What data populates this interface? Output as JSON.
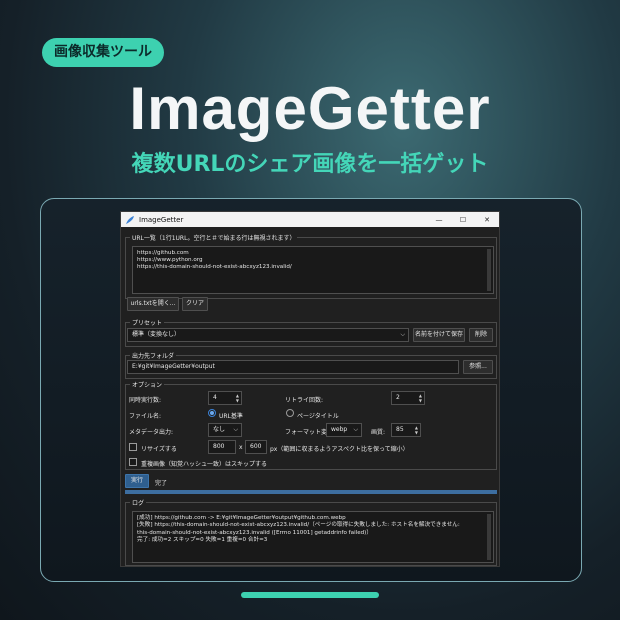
{
  "promo": {
    "badge": "画像収集ツール",
    "title": "ImageGetter",
    "subtitle": "複数URLのシェア画像を一括ゲット"
  },
  "window": {
    "title": "ImageGetter",
    "min": "—",
    "max": "☐",
    "close": "✕"
  },
  "url_list": {
    "label": "URL一覧（1行1URL。空行と＃で始まる行は無視されます）",
    "lines": [
      "https://github.com",
      "https://www.python.org",
      "https://this-domain-should-not-exist-abcxyz123.invalid/"
    ],
    "open_button": "urls.txtを開く...",
    "clear_button": "クリア"
  },
  "preset": {
    "label": "プリセット",
    "selected": "標準（変換なし）",
    "save_button": "名前を付けて保存",
    "delete_button": "削除"
  },
  "output": {
    "label": "出力先フォルダ",
    "path": "E:¥git¥ImageGetter¥output",
    "browse_button": "参照..."
  },
  "options": {
    "label": "オプション",
    "concurrency_label": "同時実行数:",
    "concurrency_value": "4",
    "retry_label": "リトライ回数:",
    "retry_value": "2",
    "filename_label": "ファイル名:",
    "filename_url": "URL基準",
    "filename_title": "ページタイトル",
    "filename_selected": "URL基準",
    "metadata_label": "メタデータ出力:",
    "metadata_value": "なし",
    "format_label": "フォーマット変換:",
    "format_value": "webp",
    "quality_label": "画質:",
    "quality_value": "85",
    "resize_label": "リサイズする",
    "resize_checked": false,
    "width_value": "800",
    "times": "x",
    "height_value": "600",
    "resize_note": "px（範囲に収まるようアスペクト比を保って縮小）",
    "skip_dup_label": "重複画像（知覚ハッシュ一致）はスキップする",
    "skip_dup_checked": false
  },
  "actions": {
    "run_button": "実行",
    "status": "完了",
    "progress": 1.0
  },
  "log": {
    "label": "ログ",
    "lines": [
      "[成功] https://github.com -> E:¥git¥ImageGetter¥output¥github.com.webp",
      "[失敗] https://this-domain-should-not-exist-abcxyz123.invalid/（ページの取得に失敗しました: ホスト名を解決できません:",
      "this-domain-should-not-exist-abcxyz123.invalid ([Errno 11001] getaddrinfo failed)）",
      "",
      "完了: 成功=2 スキップ=0 失敗=1 重複=0 合計=3"
    ]
  },
  "colors": {
    "accent": "#3dd1b0",
    "progress": "#3d6ea0",
    "run_button": "#2f5f8f"
  }
}
